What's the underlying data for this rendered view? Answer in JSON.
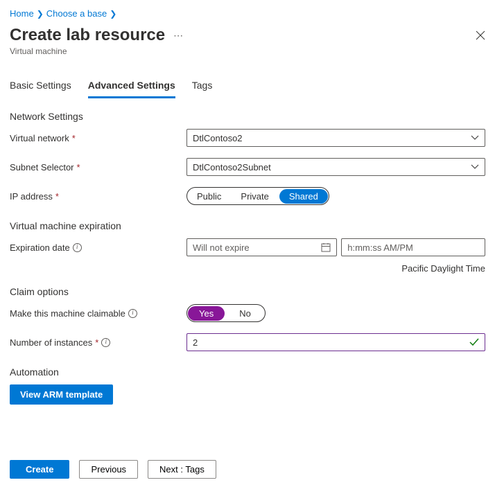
{
  "breadcrumb": {
    "home": "Home",
    "chooseBase": "Choose a base"
  },
  "title": "Create lab resource",
  "subtitle": "Virtual machine",
  "tabs": {
    "basic": "Basic Settings",
    "advanced": "Advanced Settings",
    "tags": "Tags"
  },
  "networkSection": {
    "header": "Network Settings",
    "vnetLabel": "Virtual network",
    "vnetValue": "DtlContoso2",
    "subnetLabel": "Subnet Selector",
    "subnetValue": "DtlContoso2Subnet",
    "ipLabel": "IP address",
    "ipOptions": {
      "public": "Public",
      "private": "Private",
      "shared": "Shared"
    }
  },
  "expirationSection": {
    "header": "Virtual machine expiration",
    "dateLabel": "Expiration date",
    "datePlaceholder": "Will not expire",
    "timePlaceholder": "h:mm:ss AM/PM",
    "timezone": "Pacific Daylight Time"
  },
  "claimSection": {
    "header": "Claim options",
    "claimableLabel": "Make this machine claimable",
    "yes": "Yes",
    "no": "No",
    "instancesLabel": "Number of instances",
    "instancesValue": "2"
  },
  "automationSection": {
    "header": "Automation",
    "viewArm": "View ARM template"
  },
  "footer": {
    "create": "Create",
    "previous": "Previous",
    "next": "Next : Tags"
  }
}
